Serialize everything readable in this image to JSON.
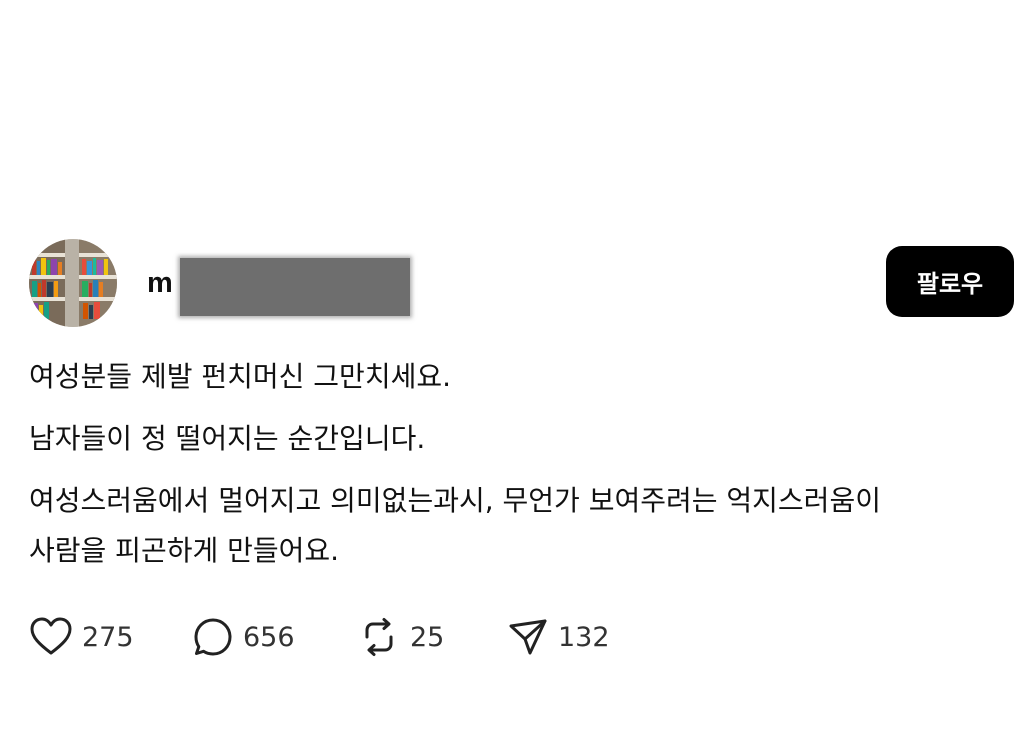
{
  "post": {
    "username_visible": "m",
    "follow_label": "팔로우",
    "paragraphs": [
      "여성분들 제발 펀치머신 그만치세요.",
      "남자들이 정 떨어지는 순간입니다.",
      "여성스러움에서 멀어지고 의미없는과시, 무언가 보여주려는 억지스러움이",
      "사람을 피곤하게 만들어요."
    ],
    "stats": {
      "likes": "275",
      "replies": "656",
      "reposts": "25",
      "shares": "132"
    }
  },
  "icons": {
    "like": "heart-icon",
    "reply": "speech-bubble-icon",
    "repost": "repost-icon",
    "share": "send-icon"
  },
  "colors": {
    "follow_button_bg": "#000000",
    "text": "#111111",
    "redaction": "#6e6e6e"
  }
}
